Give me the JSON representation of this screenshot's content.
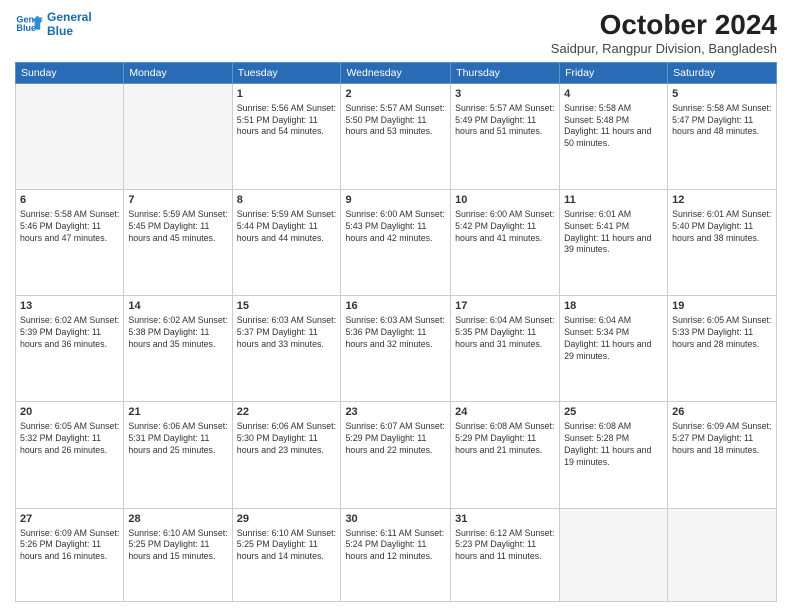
{
  "header": {
    "logo_line1": "General",
    "logo_line2": "Blue",
    "month": "October 2024",
    "location": "Saidpur, Rangpur Division, Bangladesh"
  },
  "weekdays": [
    "Sunday",
    "Monday",
    "Tuesday",
    "Wednesday",
    "Thursday",
    "Friday",
    "Saturday"
  ],
  "weeks": [
    [
      {
        "day": "",
        "info": ""
      },
      {
        "day": "",
        "info": ""
      },
      {
        "day": "1",
        "info": "Sunrise: 5:56 AM\nSunset: 5:51 PM\nDaylight: 11 hours\nand 54 minutes."
      },
      {
        "day": "2",
        "info": "Sunrise: 5:57 AM\nSunset: 5:50 PM\nDaylight: 11 hours\nand 53 minutes."
      },
      {
        "day": "3",
        "info": "Sunrise: 5:57 AM\nSunset: 5:49 PM\nDaylight: 11 hours\nand 51 minutes."
      },
      {
        "day": "4",
        "info": "Sunrise: 5:58 AM\nSunset: 5:48 PM\nDaylight: 11 hours\nand 50 minutes."
      },
      {
        "day": "5",
        "info": "Sunrise: 5:58 AM\nSunset: 5:47 PM\nDaylight: 11 hours\nand 48 minutes."
      }
    ],
    [
      {
        "day": "6",
        "info": "Sunrise: 5:58 AM\nSunset: 5:46 PM\nDaylight: 11 hours\nand 47 minutes."
      },
      {
        "day": "7",
        "info": "Sunrise: 5:59 AM\nSunset: 5:45 PM\nDaylight: 11 hours\nand 45 minutes."
      },
      {
        "day": "8",
        "info": "Sunrise: 5:59 AM\nSunset: 5:44 PM\nDaylight: 11 hours\nand 44 minutes."
      },
      {
        "day": "9",
        "info": "Sunrise: 6:00 AM\nSunset: 5:43 PM\nDaylight: 11 hours\nand 42 minutes."
      },
      {
        "day": "10",
        "info": "Sunrise: 6:00 AM\nSunset: 5:42 PM\nDaylight: 11 hours\nand 41 minutes."
      },
      {
        "day": "11",
        "info": "Sunrise: 6:01 AM\nSunset: 5:41 PM\nDaylight: 11 hours\nand 39 minutes."
      },
      {
        "day": "12",
        "info": "Sunrise: 6:01 AM\nSunset: 5:40 PM\nDaylight: 11 hours\nand 38 minutes."
      }
    ],
    [
      {
        "day": "13",
        "info": "Sunrise: 6:02 AM\nSunset: 5:39 PM\nDaylight: 11 hours\nand 36 minutes."
      },
      {
        "day": "14",
        "info": "Sunrise: 6:02 AM\nSunset: 5:38 PM\nDaylight: 11 hours\nand 35 minutes."
      },
      {
        "day": "15",
        "info": "Sunrise: 6:03 AM\nSunset: 5:37 PM\nDaylight: 11 hours\nand 33 minutes."
      },
      {
        "day": "16",
        "info": "Sunrise: 6:03 AM\nSunset: 5:36 PM\nDaylight: 11 hours\nand 32 minutes."
      },
      {
        "day": "17",
        "info": "Sunrise: 6:04 AM\nSunset: 5:35 PM\nDaylight: 11 hours\nand 31 minutes."
      },
      {
        "day": "18",
        "info": "Sunrise: 6:04 AM\nSunset: 5:34 PM\nDaylight: 11 hours\nand 29 minutes."
      },
      {
        "day": "19",
        "info": "Sunrise: 6:05 AM\nSunset: 5:33 PM\nDaylight: 11 hours\nand 28 minutes."
      }
    ],
    [
      {
        "day": "20",
        "info": "Sunrise: 6:05 AM\nSunset: 5:32 PM\nDaylight: 11 hours\nand 26 minutes."
      },
      {
        "day": "21",
        "info": "Sunrise: 6:06 AM\nSunset: 5:31 PM\nDaylight: 11 hours\nand 25 minutes."
      },
      {
        "day": "22",
        "info": "Sunrise: 6:06 AM\nSunset: 5:30 PM\nDaylight: 11 hours\nand 23 minutes."
      },
      {
        "day": "23",
        "info": "Sunrise: 6:07 AM\nSunset: 5:29 PM\nDaylight: 11 hours\nand 22 minutes."
      },
      {
        "day": "24",
        "info": "Sunrise: 6:08 AM\nSunset: 5:29 PM\nDaylight: 11 hours\nand 21 minutes."
      },
      {
        "day": "25",
        "info": "Sunrise: 6:08 AM\nSunset: 5:28 PM\nDaylight: 11 hours\nand 19 minutes."
      },
      {
        "day": "26",
        "info": "Sunrise: 6:09 AM\nSunset: 5:27 PM\nDaylight: 11 hours\nand 18 minutes."
      }
    ],
    [
      {
        "day": "27",
        "info": "Sunrise: 6:09 AM\nSunset: 5:26 PM\nDaylight: 11 hours\nand 16 minutes."
      },
      {
        "day": "28",
        "info": "Sunrise: 6:10 AM\nSunset: 5:25 PM\nDaylight: 11 hours\nand 15 minutes."
      },
      {
        "day": "29",
        "info": "Sunrise: 6:10 AM\nSunset: 5:25 PM\nDaylight: 11 hours\nand 14 minutes."
      },
      {
        "day": "30",
        "info": "Sunrise: 6:11 AM\nSunset: 5:24 PM\nDaylight: 11 hours\nand 12 minutes."
      },
      {
        "day": "31",
        "info": "Sunrise: 6:12 AM\nSunset: 5:23 PM\nDaylight: 11 hours\nand 11 minutes."
      },
      {
        "day": "",
        "info": ""
      },
      {
        "day": "",
        "info": ""
      }
    ]
  ]
}
